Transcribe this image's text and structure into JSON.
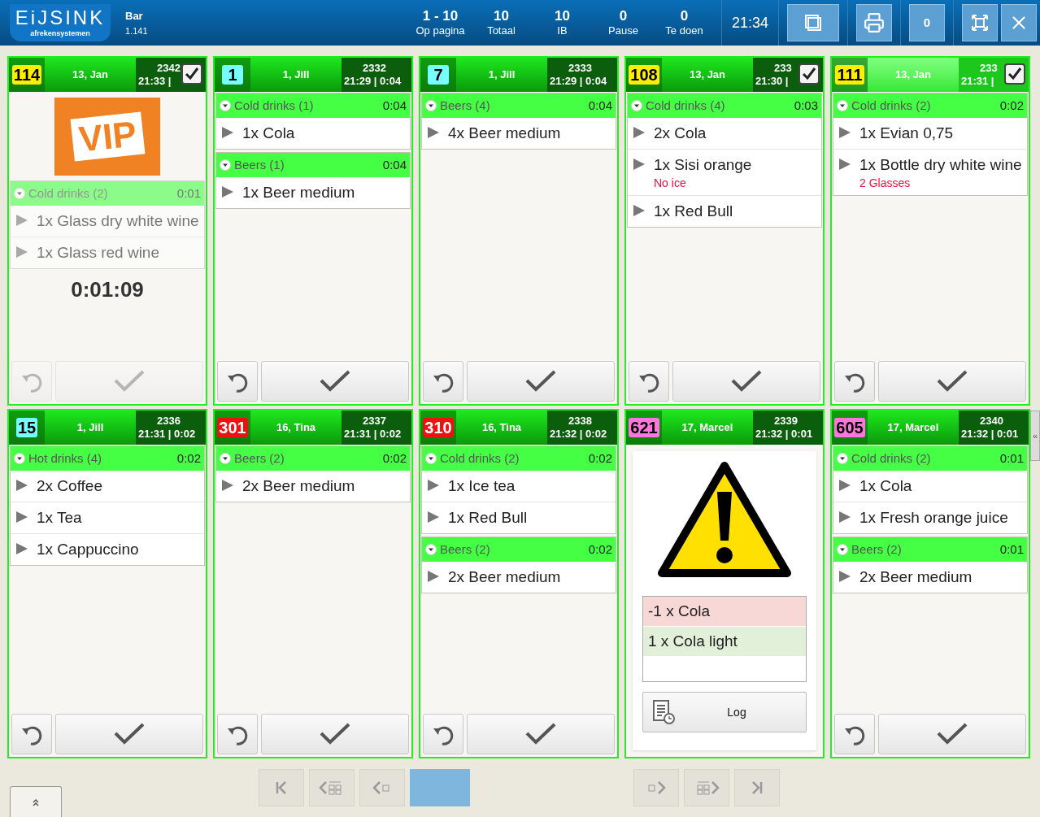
{
  "header": {
    "logo": {
      "name": "EiJSINK",
      "tagline": "afrekensystemen"
    },
    "station": "Bar",
    "version": "1.141",
    "stats": [
      {
        "value": "1 - 10",
        "label": "Op pagina"
      },
      {
        "value": "10",
        "label": "Totaal"
      },
      {
        "value": "10",
        "label": "IB"
      },
      {
        "value": "0",
        "label": "Pause"
      },
      {
        "value": "0",
        "label": "Te doen"
      }
    ],
    "clock": "21:34",
    "counter": "0"
  },
  "cards": [
    {
      "kind": "vip",
      "table": "114",
      "color": "#ffee00",
      "name": "13, Jan",
      "order": "2342",
      "time": "21:33 |",
      "checked": true,
      "highlighted": false,
      "vip_label": "VIP",
      "timer": "0:01:09",
      "groups": [
        {
          "name": "Cold drinks (2)",
          "time": "0:01",
          "items": [
            {
              "text": "1x Glass dry white wine"
            },
            {
              "text": "1x Glass red wine"
            }
          ]
        }
      ]
    },
    {
      "kind": "order",
      "table": "1",
      "color": "#77ffff",
      "name": "1, Jill",
      "order": "2332",
      "time": "21:29 | 0:04",
      "checked": false,
      "highlighted": false,
      "groups": [
        {
          "name": "Cold drinks (1)",
          "time": "0:04",
          "items": [
            {
              "text": "1x Cola"
            }
          ]
        },
        {
          "name": "Beers (1)",
          "time": "0:04",
          "items": [
            {
              "text": "1x Beer medium"
            }
          ]
        }
      ]
    },
    {
      "kind": "order",
      "table": "7",
      "color": "#77ffff",
      "name": "1, Jill",
      "order": "2333",
      "time": "21:29 | 0:04",
      "checked": false,
      "highlighted": false,
      "groups": [
        {
          "name": "Beers (4)",
          "time": "0:04",
          "items": [
            {
              "text": "4x Beer medium"
            }
          ]
        }
      ]
    },
    {
      "kind": "order",
      "table": "108",
      "color": "#ffee00",
      "name": "13, Jan",
      "order": "233",
      "time": "21:30 |",
      "checked": true,
      "highlighted": false,
      "groups": [
        {
          "name": "Cold drinks (4)",
          "time": "0:03",
          "items": [
            {
              "text": "2x Cola"
            },
            {
              "text": "1x Sisi orange",
              "note": "No ice"
            },
            {
              "text": "1x Red Bull"
            }
          ]
        }
      ]
    },
    {
      "kind": "order",
      "table": "111",
      "color": "#ffee00",
      "name": "13, Jan",
      "order": "233",
      "time": "21:31 |",
      "checked": true,
      "highlighted": true,
      "groups": [
        {
          "name": "Cold drinks (2)",
          "time": "0:02",
          "items": [
            {
              "text": "1x Evian 0,75"
            },
            {
              "text": "1x Bottle dry white wine",
              "note": "2 Glasses"
            }
          ]
        }
      ]
    },
    {
      "kind": "order",
      "table": "15",
      "color": "#77ffff",
      "name": "1, Jill",
      "order": "2336",
      "time": "21:31 | 0:02",
      "checked": false,
      "highlighted": false,
      "groups": [
        {
          "name": "Hot drinks (4)",
          "time": "0:02",
          "items": [
            {
              "text": "2x Coffee"
            },
            {
              "text": "1x Tea"
            },
            {
              "text": "1x Cappuccino"
            }
          ]
        }
      ]
    },
    {
      "kind": "order",
      "table": "301",
      "color": "#ee1111",
      "name": "16, Tina",
      "order": "2337",
      "time": "21:31 | 0:02",
      "checked": false,
      "highlighted": false,
      "groups": [
        {
          "name": "Beers (2)",
          "time": "0:02",
          "items": [
            {
              "text": "2x Beer medium"
            }
          ]
        }
      ]
    },
    {
      "kind": "order",
      "table": "310",
      "color": "#ee1111",
      "name": "16, Tina",
      "order": "2338",
      "time": "21:32 | 0:02",
      "checked": false,
      "highlighted": false,
      "groups": [
        {
          "name": "Cold drinks (2)",
          "time": "0:02",
          "items": [
            {
              "text": "1x Ice tea"
            },
            {
              "text": "1x Red Bull"
            }
          ]
        },
        {
          "name": "Beers (2)",
          "time": "0:02",
          "items": [
            {
              "text": "2x Beer medium"
            }
          ]
        }
      ]
    },
    {
      "kind": "alert",
      "table": "621",
      "color": "#ff77dd",
      "name": "17, Marcel",
      "order": "2339",
      "time": "21:32 | 0:01",
      "checked": false,
      "highlighted": false,
      "changes": [
        {
          "kind": "removed",
          "text": "-1 x Cola"
        },
        {
          "kind": "added",
          "text": "1 x Cola light"
        }
      ],
      "log_label": "Log"
    },
    {
      "kind": "order",
      "table": "605",
      "color": "#ff77dd",
      "name": "17, Marcel",
      "order": "2340",
      "time": "21:32 | 0:01",
      "checked": false,
      "highlighted": false,
      "groups": [
        {
          "name": "Cold drinks (2)",
          "time": "0:01",
          "items": [
            {
              "text": "1x Cola"
            },
            {
              "text": "1x Fresh orange juice"
            }
          ]
        },
        {
          "name": "Beers (2)",
          "time": "0:01",
          "items": [
            {
              "text": "2x Beer medium"
            }
          ]
        }
      ]
    }
  ],
  "collapse_tab": "«"
}
